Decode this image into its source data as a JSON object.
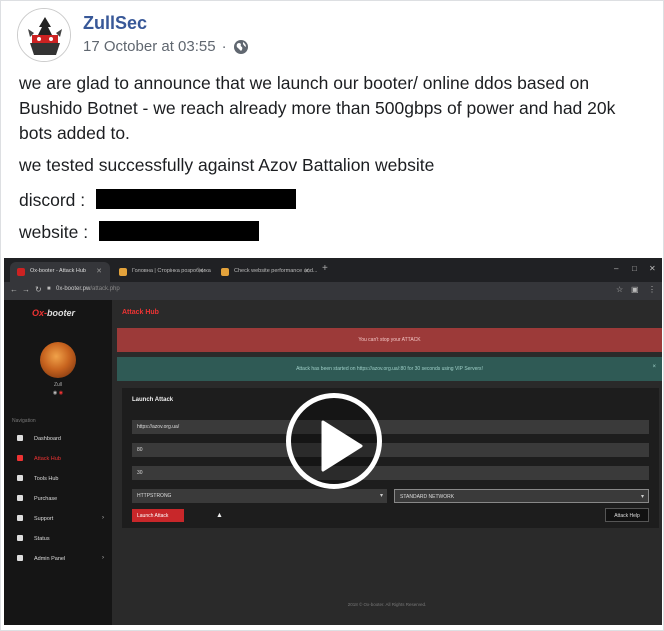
{
  "post": {
    "author": "ZullSec",
    "timestamp": "17 October at 03:55",
    "separator": "·",
    "privacy_icon": "globe-icon",
    "paragraph1": "we are glad to announce that we launch our booter/ online ddos based on Bushido Botnet - we reach already more than 500gbps of power and had 20k bots added to.",
    "paragraph2": "we tested successfully against Azov Battalion website",
    "discord_label": "discord :",
    "website_label": "website :"
  },
  "video": {
    "play_icon": "play-icon",
    "browser": {
      "tabs": [
        {
          "label": "Ox-booter - Attack Hub"
        },
        {
          "label": "Головна | Сторінка розробника"
        },
        {
          "label": "Check website performance and..."
        }
      ],
      "new_tab": "+",
      "url_host": "0x-booter.pw",
      "url_path": "/attack.php"
    },
    "sidebar": {
      "logo_prefix": "Ox-",
      "logo_suffix": "booter",
      "username": "Zull",
      "nav_header": "Navigation",
      "items": [
        {
          "label": "Dashboard"
        },
        {
          "label": "Attack Hub"
        },
        {
          "label": "Tools Hub"
        },
        {
          "label": "Purchase"
        },
        {
          "label": "Support"
        },
        {
          "label": "Status"
        },
        {
          "label": "Admin Panel"
        }
      ]
    },
    "main": {
      "title": "Attack Hub",
      "alert_error": "You can't stop your ATTACK",
      "alert_success": "Attack has been started on https://azov.org.ua/:80 for 30 seconds using VIP Servers!",
      "panel_title": "Launch Attack",
      "host_value": "https://azov.org.ua/",
      "port_value": "80",
      "time_value": "30",
      "method_value": "HTTPSTRONG",
      "network_value": "STANDARD NETWORK",
      "launch_label": "Launch Attack",
      "help_label": "Attack Help",
      "footer": "2018 © Ox-booter. All Rights Reserved."
    }
  }
}
